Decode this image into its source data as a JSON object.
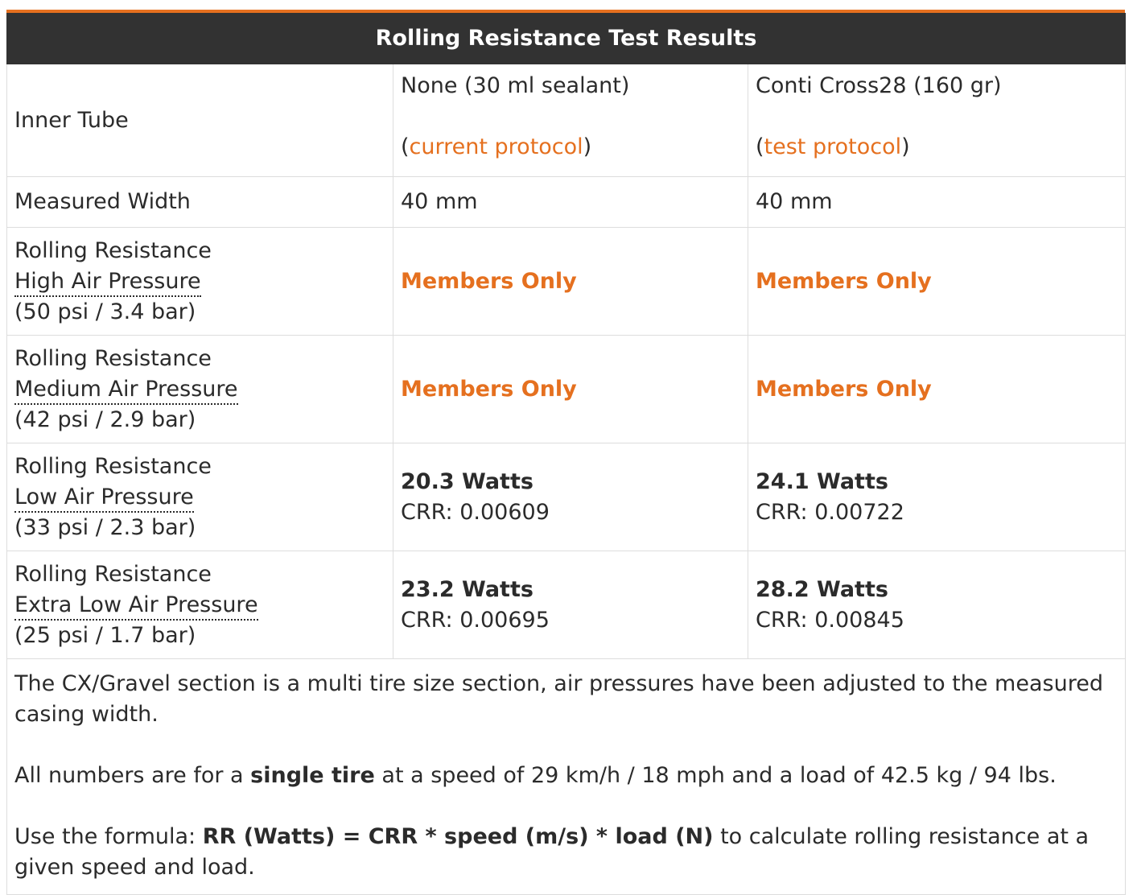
{
  "table": {
    "title": "Rolling Resistance Test Results",
    "inner_tube": {
      "label": "Inner Tube",
      "col1": {
        "text": "None (30 ml sealant)",
        "open": "(",
        "link": "current protocol",
        "close": ")"
      },
      "col2": {
        "text": "Conti Cross28 (160 gr)",
        "open": "(",
        "link": "test protocol",
        "close": ")"
      }
    },
    "measured_width": {
      "label": "Measured Width",
      "col1": "40 mm",
      "col2": "40 mm"
    },
    "rows": [
      {
        "line1": "Rolling Resistance",
        "line2": "High Air Pressure",
        "line3": "(50 psi / 3.4 bar)",
        "col1": "Members Only",
        "col2": "Members Only"
      },
      {
        "line1": "Rolling Resistance",
        "line2": "Medium Air Pressure",
        "line3": "(42 psi / 2.9 bar)",
        "col1": "Members Only",
        "col2": "Members Only"
      },
      {
        "line1": "Rolling Resistance",
        "line2": "Low Air Pressure",
        "line3": "(33 psi / 2.3 bar)",
        "col1_watts": "20.3 Watts",
        "col1_crr": "CRR: 0.00609",
        "col2_watts": "24.1 Watts",
        "col2_crr": "CRR: 0.00722"
      },
      {
        "line1": "Rolling Resistance",
        "line2": "Extra Low Air Pressure",
        "line3": "(25 psi / 1.7 bar)",
        "col1_watts": "23.2 Watts",
        "col1_crr": "CRR: 0.00695",
        "col2_watts": "28.2 Watts",
        "col2_crr": "CRR: 0.00845"
      }
    ],
    "notes": {
      "p1": "The CX/Gravel section is a multi tire size section, air pressures have been adjusted to the measured casing width.",
      "p2_before": "All numbers are for a ",
      "p2_bold": "single tire",
      "p2_after": " at a speed of 29 km/h / 18 mph and a load of 42.5 kg / 94 lbs.",
      "p3_before": "Use the formula: ",
      "p3_bold": "RR (Watts) = CRR * speed (m/s) * load (N)",
      "p3_after": " to calculate rolling resistance at a given speed and load."
    }
  },
  "colors": {
    "accent": "#e5701f",
    "header_bg": "#323232",
    "border": "#dddddd",
    "text": "#2b2b2b"
  }
}
